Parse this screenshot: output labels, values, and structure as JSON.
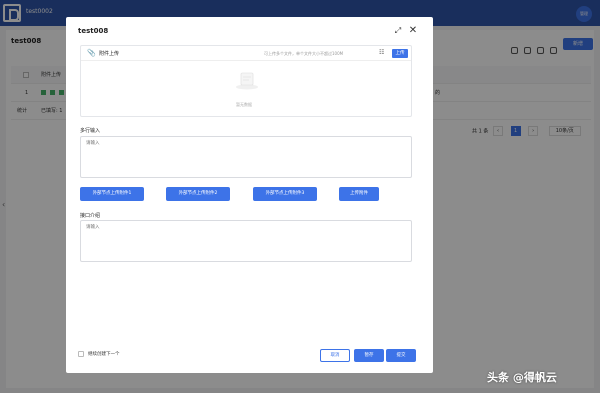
{
  "app": {
    "title": "test0002",
    "avatar_text": "管理"
  },
  "page": {
    "title": "test008",
    "new_button": "新增",
    "columns": [
      "附件上传"
    ],
    "row": {
      "index": "1",
      "tail_text": "的"
    },
    "summary": {
      "label": "统计",
      "filled": "已填写: 1"
    }
  },
  "pager": {
    "total": "共 1 条",
    "prev": "‹",
    "current": "1",
    "next": "›",
    "size": "10条/页"
  },
  "modal": {
    "title": "test008",
    "attachment": {
      "label": "附件上传",
      "hint": "可上传多个文件，单个文件大小不超过100M",
      "upload_button": "上传",
      "empty_text": "暂无数据"
    },
    "multiline": {
      "label": "多行输入",
      "placeholder": "请输入"
    },
    "external_buttons": [
      "外部节点上传附件1",
      "外部节点上传附件2",
      "外部节点上传附件3",
      "上传附件"
    ],
    "intro": {
      "label": "接口介绍",
      "placeholder": "请输入"
    },
    "footer": {
      "continue_label": "继续创建下一个",
      "cancel": "取消",
      "save_draft": "暂存",
      "submit": "提交"
    }
  },
  "watermark": "头条 @得帆云",
  "colors": {
    "primary": "#3d73e8",
    "topbar": "#2f55a8"
  }
}
